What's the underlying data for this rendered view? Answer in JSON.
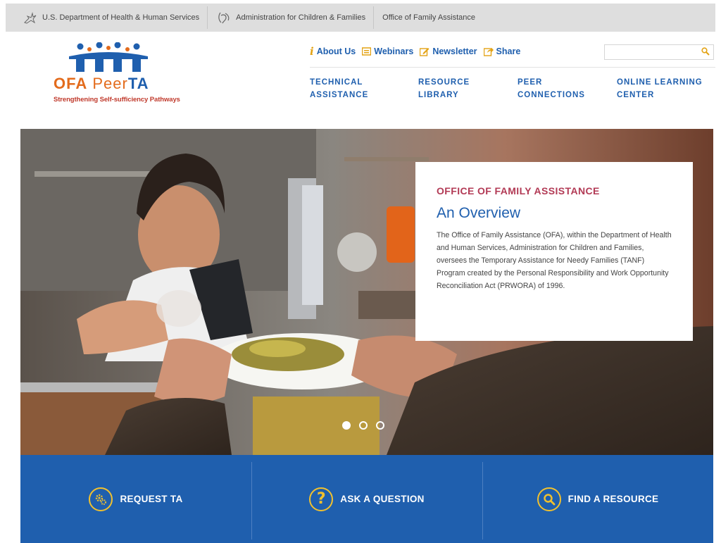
{
  "agency_bar": {
    "items": [
      {
        "label": "U.S. Department of Health & Human Services",
        "icon": "hhs-eagle-icon"
      },
      {
        "label": "Administration for Children & Families",
        "icon": "acf-family-icon"
      },
      {
        "label": "Office of Family Assistance"
      }
    ]
  },
  "logo": {
    "ofa": "OFA",
    "peer": "Peer",
    "ta": "TA",
    "tagline": "Strengthening Self-sufficiency Pathways"
  },
  "utility_nav": {
    "about": "About Us",
    "webinars": "Webinars",
    "newsletter": "Newsletter",
    "share": "Share"
  },
  "search": {
    "placeholder": "",
    "value": ""
  },
  "main_nav": {
    "items": [
      {
        "line1": "TECHNICAL",
        "line2": "ASSISTANCE"
      },
      {
        "line1": "RESOURCE",
        "line2": "LIBRARY"
      },
      {
        "line1": "PEER",
        "line2": "CONNECTIONS"
      },
      {
        "line1": "ONLINE LEARNING",
        "line2": "CENTER"
      }
    ]
  },
  "hero": {
    "eyebrow": "OFFICE OF FAMILY ASSISTANCE",
    "title": "An Overview",
    "body": "The Office of Family Assistance (OFA), within the Department of Health and Human Services, Administration for Children and Families, oversees the Temporary Assistance for Needy Families (TANF) Program created by the Personal Responsibility and Work Opportunity Reconciliation Act (PRWORA) of 1996.",
    "slides": 3,
    "active_slide": 1
  },
  "actions": [
    {
      "label": "REQUEST TA",
      "icon": "gears-icon"
    },
    {
      "label": "ASK A QUESTION",
      "icon": "question-mark-icon"
    },
    {
      "label": "FIND A RESOURCE",
      "icon": "magnifier-icon"
    }
  ],
  "colors": {
    "brand_blue": "#1f5fae",
    "accent_orange": "#e36b1c",
    "accent_gold": "#f1c12e",
    "heading_maroon": "#b23a55",
    "topbar_gray": "#dedede"
  }
}
